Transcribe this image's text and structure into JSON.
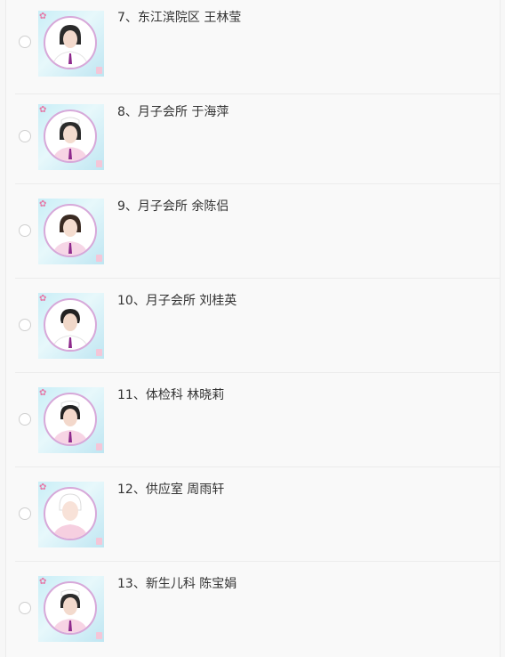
{
  "items": [
    {
      "label": "7、东江滨院区 王林莹"
    },
    {
      "label": "8、月子会所 于海萍"
    },
    {
      "label": "9、月子会所 余陈侣"
    },
    {
      "label": "10、月子会所 刘桂英"
    },
    {
      "label": "11、体检科 林晓莉"
    },
    {
      "label": "12、供应室 周雨轩"
    },
    {
      "label": "13、新生儿科 陈宝娟"
    }
  ],
  "colors": {
    "photo_bg": "#c9eef7",
    "ring": "#d7a8d9",
    "uniform_accent": "#8e2a8c"
  }
}
